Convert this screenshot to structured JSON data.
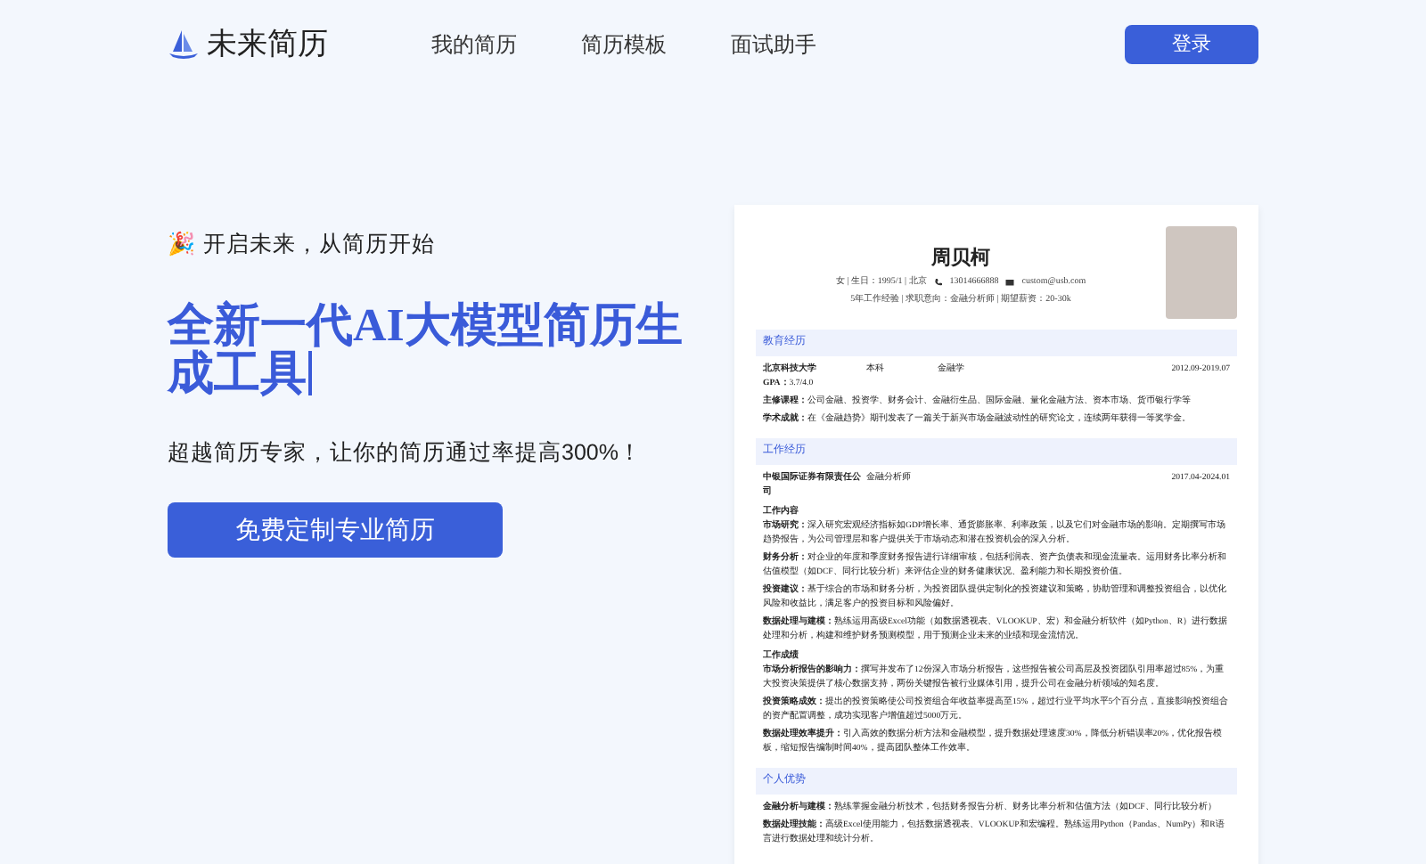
{
  "nav": {
    "logo_text": "未来简历",
    "links": [
      {
        "label": "我的简历"
      },
      {
        "label": "简历模板"
      },
      {
        "label": "面试助手"
      }
    ],
    "login_button": "登录"
  },
  "hero": {
    "tagline_icon": "🎉",
    "tagline": "开启未来，从简历开始",
    "title": "全新一代AI大模型简历生成工具",
    "subtitle": "超越简历专家，让你的简历通过率提高300%！",
    "cta_button": "免费定制专业简历"
  },
  "resume": {
    "name": "周贝柯",
    "info_items": [
      {
        "kind": "text",
        "text": "女 | 生日：1995/1 | 北京"
      },
      {
        "kind": "phone",
        "text": "13014666888"
      },
      {
        "kind": "email",
        "text": "custom@usb.com"
      }
    ],
    "info_line_2": "5年工作经验 | 求职意向：金融分析师 | 期望薪资：20-30k",
    "sections": [
      {
        "title": "教育经历",
        "blocks": [
          {
            "kind": "header",
            "columns": [
              "北京科技大学",
              "本科",
              "金融学"
            ],
            "date": "2012.09-2019.07"
          },
          {
            "kind": "paragraph",
            "label": "GPA：",
            "text": "3.7/4.0"
          },
          {
            "kind": "paragraph",
            "label": "主修课程：",
            "text": "公司金融、投资学、财务会计、金融衍生品、国际金融、量化金融方法、资本市场、货币银行学等"
          },
          {
            "kind": "paragraph",
            "label": "学术成就：",
            "text": "在《金融趋势》期刊发表了一篇关于新兴市场金融波动性的研究论文，连续两年获得一等奖学金。"
          }
        ]
      },
      {
        "title": "工作经历",
        "blocks": [
          {
            "kind": "header",
            "columns": [
              "中银国际证券有限责任公司",
              "金融分析师"
            ],
            "date": "2017.04-2024.01"
          },
          {
            "kind": "subheading",
            "text": "工作内容"
          },
          {
            "kind": "paragraph",
            "label": "市场研究：",
            "text": "深入研究宏观经济指标如GDP增长率、通货膨胀率、利率政策，以及它们对金融市场的影响。定期撰写市场趋势报告，为公司管理层和客户提供关于市场动态和潜在投资机会的深入分析。"
          },
          {
            "kind": "paragraph",
            "label": "财务分析：",
            "text": "对企业的年度和季度财务报告进行详细审核，包括利润表、资产负债表和现金流量表。运用财务比率分析和估值模型（如DCF、同行比较分析）来评估企业的财务健康状况、盈利能力和长期投资价值。"
          },
          {
            "kind": "paragraph",
            "label": "投资建议：",
            "text": "基于综合的市场和财务分析，为投资团队提供定制化的投资建议和策略，协助管理和调整投资组合，以优化风险和收益比，满足客户的投资目标和风险偏好。"
          },
          {
            "kind": "paragraph",
            "label": "数据处理与建模：",
            "text": "熟练运用高级Excel功能（如数据透视表、VLOOKUP、宏）和金融分析软件（如Python、R）进行数据处理和分析，构建和维护财务预测模型，用于预测企业未来的业绩和现金流情况。"
          },
          {
            "kind": "subheading",
            "text": "工作成绩"
          },
          {
            "kind": "paragraph",
            "label": "市场分析报告的影响力：",
            "text": "撰写并发布了12份深入市场分析报告，这些报告被公司高层及投资团队引用率超过85%，为重大投资决策提供了核心数据支持，两份关键报告被行业媒体引用，提升公司在金融分析领域的知名度。"
          },
          {
            "kind": "paragraph",
            "label": "投资策略成效：",
            "text": "提出的投资策略使公司投资组合年收益率提高至15%，超过行业平均水平5个百分点，直接影响投资组合的资产配置调整，成功实现客户增值超过5000万元。"
          },
          {
            "kind": "paragraph",
            "label": "数据处理效率提升：",
            "text": "引入高效的数据分析方法和金融模型，提升数据处理速度30%，降低分析错误率20%，优化报告模板，缩短报告编制时间40%，提高团队整体工作效率。"
          }
        ]
      },
      {
        "title": "个人优势",
        "blocks": [
          {
            "kind": "paragraph",
            "label": "金融分析与建模：",
            "text": "熟练掌握金融分析技术，包括财务报告分析、财务比率分析和估值方法（如DCF、同行比较分析）"
          },
          {
            "kind": "paragraph",
            "label": "数据处理技能：",
            "text": "高级Excel使用能力，包括数据透视表、VLOOKUP和宏编程。熟练运用Python（Pandas、NumPy）和R语言进行数据处理和统计分析。"
          }
        ]
      }
    ]
  }
}
